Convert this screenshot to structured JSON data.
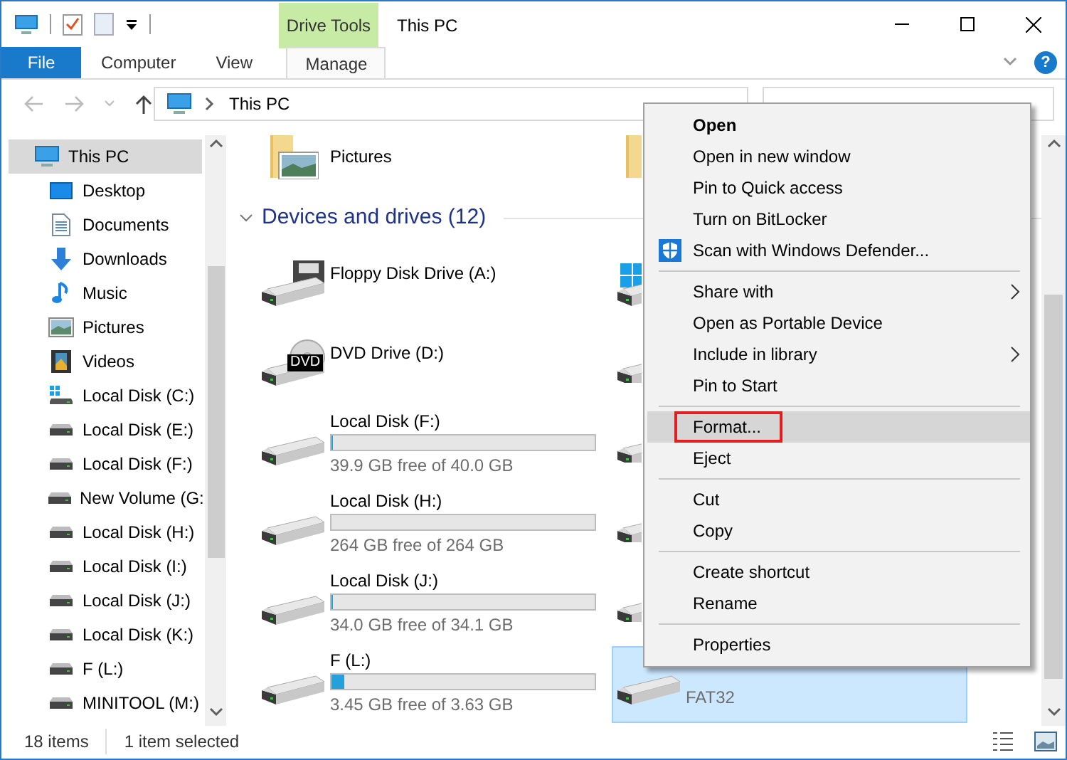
{
  "window": {
    "title": "This PC",
    "contextual_group": "Drive Tools"
  },
  "ribbon_tabs": [
    {
      "label": "File",
      "kind": "file"
    },
    {
      "label": "Computer",
      "kind": "tab"
    },
    {
      "label": "View",
      "kind": "tab"
    },
    {
      "label": "Manage",
      "kind": "contextual"
    }
  ],
  "help_button": {
    "label": "?"
  },
  "address_bar": {
    "path": "This PC"
  },
  "navigation": [
    {
      "label": "This PC",
      "kind": "pc",
      "selected": true,
      "children": [
        {
          "label": "Desktop",
          "kind": "desktop",
          "selected": false
        },
        {
          "label": "Documents",
          "kind": "documents",
          "selected": false
        },
        {
          "label": "Downloads",
          "kind": "downloads",
          "selected": false
        },
        {
          "label": "Music",
          "kind": "music",
          "selected": false
        },
        {
          "label": "Pictures",
          "kind": "pictures",
          "selected": false
        },
        {
          "label": "Videos",
          "kind": "videos",
          "selected": false
        },
        {
          "label": "Local Disk (C:)",
          "kind": "system",
          "selected": false
        },
        {
          "label": "Local Disk (E:)",
          "kind": "drive",
          "selected": false
        },
        {
          "label": "Local Disk (F:)",
          "kind": "drive",
          "selected": false
        },
        {
          "label": "New Volume (G:",
          "kind": "drive",
          "selected": false
        },
        {
          "label": "Local Disk (H:)",
          "kind": "drive",
          "selected": false
        },
        {
          "label": "Local Disk (I:)",
          "kind": "drive",
          "selected": false
        },
        {
          "label": "Local Disk (J:)",
          "kind": "drive",
          "selected": false
        },
        {
          "label": "Local Disk (K:)",
          "kind": "drive",
          "selected": false
        },
        {
          "label": "F (L:)",
          "kind": "drive",
          "selected": false
        },
        {
          "label": "MINITOOL (M:)",
          "kind": "drive",
          "selected": false
        }
      ]
    }
  ],
  "folders": [
    {
      "kind": "pictures",
      "name": "Pictures"
    },
    {
      "kind": "covered"
    }
  ],
  "devices": {
    "title": "Devices and drives (12)",
    "expanded": true,
    "items": [
      {
        "kind": "floppy",
        "name": "Floppy Disk Drive (A:)",
        "selected": false
      },
      {
        "kind": "system-covered",
        "selected": false
      },
      {
        "kind": "dvd",
        "badge": "DVD",
        "name": "DVD Drive (D:)",
        "selected": false
      },
      {
        "kind": "covered",
        "selected": false
      },
      {
        "kind": "disk",
        "name": "Local Disk (F:)",
        "level": 0.0025,
        "free": "39.9 GB free of 40.0 GB",
        "selected": false
      },
      {
        "kind": "covered",
        "selected": false
      },
      {
        "kind": "disk",
        "name": "Local Disk (H:)",
        "level": 0,
        "free": "264 GB free of 264 GB",
        "selected": false
      },
      {
        "kind": "covered",
        "selected": false
      },
      {
        "kind": "disk",
        "name": "Local Disk (J:)",
        "level": 0.003,
        "free": "34.0 GB free of 34.1 GB",
        "selected": false
      },
      {
        "kind": "covered",
        "selected": false
      },
      {
        "kind": "disk",
        "name": "F (L:)",
        "level": 0.05,
        "free": "3.45 GB free of 3.63 GB",
        "selected": false
      },
      {
        "kind": "removable",
        "detail": "FAT32",
        "selected": true
      }
    ]
  },
  "status_bar": {
    "count": "18 items",
    "selection": "1 item selected"
  },
  "context_menu": {
    "groups": [
      {
        "items": [
          {
            "label": "Open",
            "default": true,
            "submenu": false,
            "highlighted": false,
            "annotated": false
          },
          {
            "label": "Open in new window",
            "default": false,
            "submenu": false,
            "highlighted": false,
            "annotated": false
          },
          {
            "label": "Pin to Quick access",
            "default": false,
            "submenu": false,
            "highlighted": false,
            "annotated": false
          },
          {
            "label": "Turn on BitLocker",
            "default": false,
            "submenu": false,
            "highlighted": false,
            "annotated": false
          },
          {
            "label": "Scan with Windows Defender...",
            "kind": "shield",
            "default": false,
            "submenu": false,
            "highlighted": false,
            "annotated": false
          }
        ]
      },
      {
        "items": [
          {
            "label": "Share with",
            "default": false,
            "submenu": true,
            "highlighted": false,
            "annotated": false
          },
          {
            "label": "Open as Portable Device",
            "default": false,
            "submenu": false,
            "highlighted": false,
            "annotated": false
          },
          {
            "label": "Include in library",
            "default": false,
            "submenu": true,
            "highlighted": false,
            "annotated": false
          },
          {
            "label": "Pin to Start",
            "default": false,
            "submenu": false,
            "highlighted": false,
            "annotated": false
          }
        ]
      },
      {
        "items": [
          {
            "label": "Format...",
            "default": false,
            "submenu": false,
            "highlighted": true,
            "annotated": true
          },
          {
            "label": "Eject",
            "default": false,
            "submenu": false,
            "highlighted": false,
            "annotated": false
          }
        ]
      },
      {
        "items": [
          {
            "label": "Cut",
            "default": false,
            "submenu": false,
            "highlighted": false,
            "annotated": false
          },
          {
            "label": "Copy",
            "default": false,
            "submenu": false,
            "highlighted": false,
            "annotated": false
          }
        ]
      },
      {
        "items": [
          {
            "label": "Create shortcut",
            "default": false,
            "submenu": false,
            "highlighted": false,
            "annotated": false
          },
          {
            "label": "Rename",
            "default": false,
            "submenu": false,
            "highlighted": false,
            "annotated": false
          }
        ]
      },
      {
        "items": [
          {
            "label": "Properties",
            "default": false,
            "submenu": false,
            "highlighted": false,
            "annotated": false
          }
        ]
      }
    ]
  }
}
